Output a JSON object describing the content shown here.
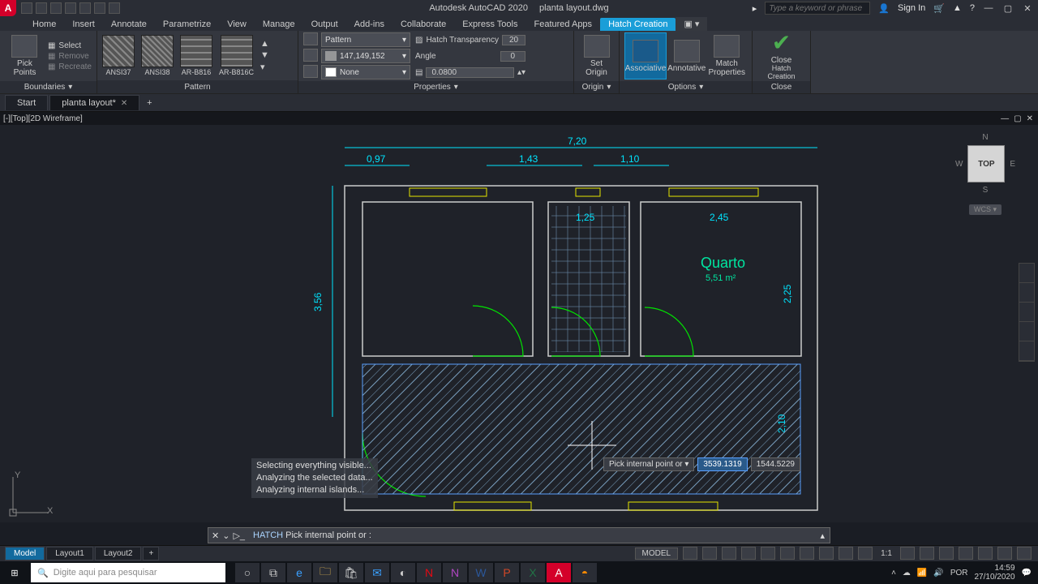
{
  "app": {
    "name": "Autodesk AutoCAD 2020",
    "file": "planta layout.dwg"
  },
  "titlebar": {
    "search_placeholder": "Type a keyword or phrase",
    "signin": "Sign In"
  },
  "menutabs": [
    "Home",
    "Insert",
    "Annotate",
    "Parametrize",
    "View",
    "Manage",
    "Output",
    "Add-ins",
    "Collaborate",
    "Express Tools",
    "Featured Apps",
    "Hatch Creation"
  ],
  "menutabs_active_index": 11,
  "ribbon": {
    "boundaries": {
      "pick_points": "Pick Points",
      "select": "Select",
      "remove": "Remove",
      "recreate": "Recreate",
      "title": "Boundaries"
    },
    "pattern": {
      "swatches": [
        "ANSI37",
        "ANSI38",
        "AR-B816",
        "AR-B816C"
      ],
      "title": "Pattern"
    },
    "properties": {
      "pattern_label": "Pattern",
      "color_value": "147,149,152",
      "none_value": "None",
      "transparency_label": "Hatch Transparency",
      "transparency_value": "20",
      "angle_label": "Angle",
      "angle_value": "0",
      "scale_value": "0.0800",
      "title": "Properties"
    },
    "origin": {
      "set": "Set",
      "origin_word": "Origin",
      "title": "Origin"
    },
    "options": {
      "associative": "Associative",
      "annotative": "Annotative",
      "match": "Match",
      "match2": "Properties",
      "title": "Options"
    },
    "close": {
      "close": "Close",
      "hatch": "Hatch Creation",
      "title": "Close"
    }
  },
  "filetabs": {
    "start": "Start",
    "doc": "planta layout*"
  },
  "viewport_label": "[-][Top][2D Wireframe]",
  "drawing": {
    "dims": {
      "total": "7,20",
      "d097": "0,97",
      "d143": "1,43",
      "d110": "1,10",
      "d356": "3,56",
      "d125": "1,25",
      "d245": "2,45",
      "d225": "2,25",
      "d210": "2,10"
    },
    "room_name": "Quarto",
    "room_area": "5,51 m²"
  },
  "viewcube": {
    "top": "TOP",
    "n": "N",
    "s": "S",
    "e": "E",
    "w": "W",
    "wcs": "WCS"
  },
  "tooltip": {
    "prompt": "Pick internal point or",
    "coord_x": "3539.1319",
    "coord_y": "1544.5229"
  },
  "cmd_scroll": [
    "Selecting everything visible...",
    "Analyzing the selected data...",
    "Analyzing internal islands..."
  ],
  "cmdline": {
    "cmd": "HATCH",
    "prompt": "Pick internal point or :"
  },
  "layout_tabs": [
    "Model",
    "Layout1",
    "Layout2"
  ],
  "statusbar": {
    "model": "MODEL",
    "scale": "1:1",
    "lang": "POR"
  },
  "taskbar": {
    "search_placeholder": "Digite aqui para pesquisar",
    "lang": "POR",
    "time": "14:59",
    "date": "27/10/2020"
  }
}
